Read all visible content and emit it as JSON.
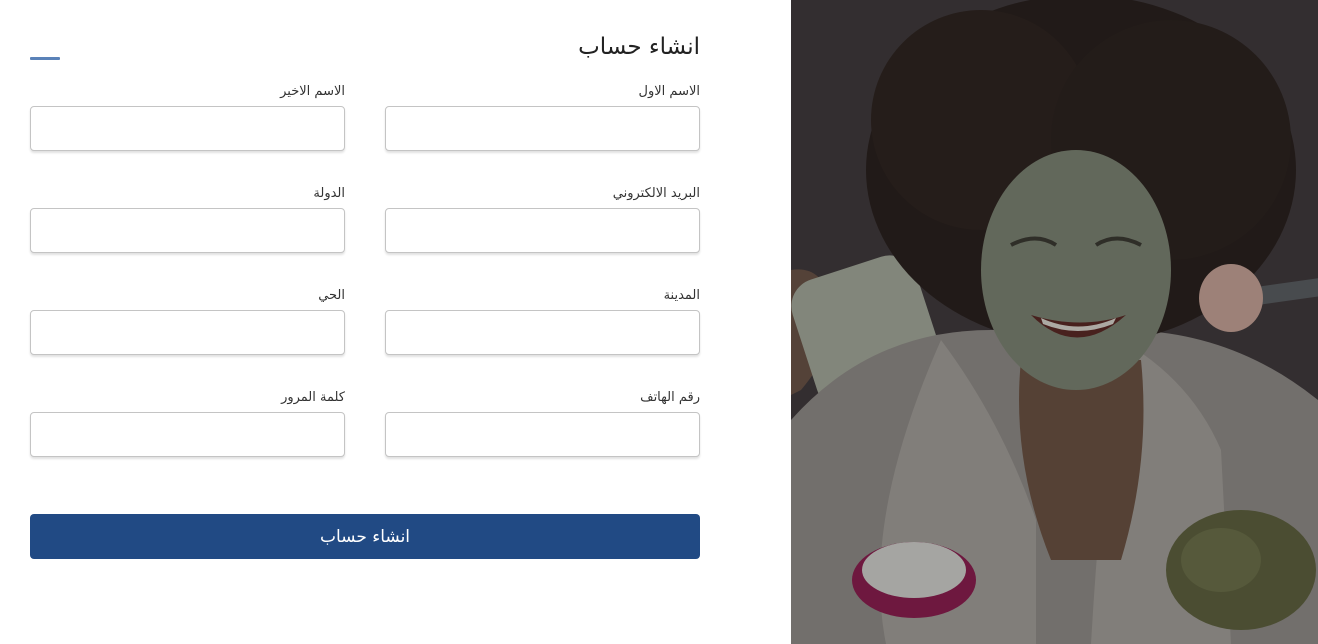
{
  "form": {
    "title": "انشاء حساب",
    "fields": {
      "first_name": {
        "label": "الاسم الاول",
        "value": ""
      },
      "last_name": {
        "label": "الاسم الاخير",
        "value": ""
      },
      "email": {
        "label": "البريد الالكتروني",
        "value": ""
      },
      "country": {
        "label": "الدولة",
        "value": ""
      },
      "city": {
        "label": "المدينة",
        "value": ""
      },
      "district": {
        "label": "الحي",
        "value": ""
      },
      "phone": {
        "label": "رقم الهاتف",
        "value": ""
      },
      "password": {
        "label": "كلمة المرور",
        "value": ""
      }
    },
    "submit_label": "انشاء حساب"
  },
  "colors": {
    "primary_button": "#214a84",
    "accent_line": "#5a82b8",
    "hero_overlay": "#3f3a3b"
  },
  "hero": {
    "image": "woman-face-mask-photo"
  }
}
